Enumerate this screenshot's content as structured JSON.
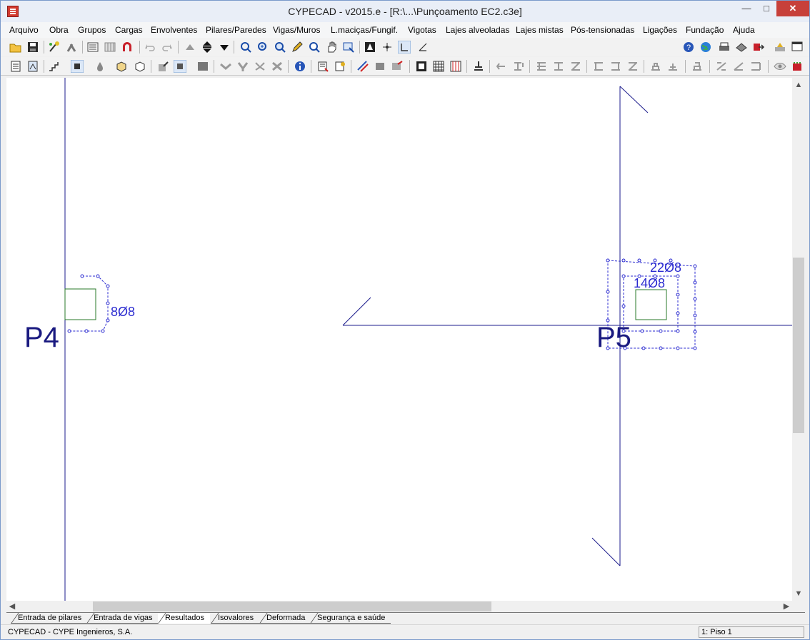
{
  "window": {
    "title": "CYPECAD - v2015.e - [R:\\...\\Punçoamento EC2.c3e]",
    "controls": {
      "minimize": "—",
      "maximize": "□",
      "close": "✕"
    }
  },
  "menu": {
    "items": [
      {
        "label": "Arquivo"
      },
      {
        "label": "Obra"
      },
      {
        "label": "Grupos"
      },
      {
        "label": "Cargas"
      },
      {
        "label": "Envolventes"
      },
      {
        "label": "Pilares/Paredes"
      },
      {
        "label": "Vigas/Muros"
      },
      {
        "label": "L.maciças/Fungif."
      },
      {
        "label": "Vigotas"
      },
      {
        "label": "Lajes alveoladas"
      },
      {
        "label": "Lajes mistas"
      },
      {
        "label": "Pós-tensionadas"
      },
      {
        "label": "Ligações"
      },
      {
        "label": "Fundação"
      },
      {
        "label": "Ajuda"
      }
    ]
  },
  "drawing": {
    "columns": [
      {
        "label": "P4",
        "reinforcement": "8Ø8"
      },
      {
        "label": "P5",
        "reinforcement_outer": "22Ø8",
        "reinforcement_inner": "14Ø8"
      }
    ],
    "colors": {
      "axis_lines": "#1c1c8c",
      "column_outline": "#2a7a2a",
      "punching_perimeter": "#2b2bd0",
      "column_labels": "#1a1a80"
    }
  },
  "tabs": [
    {
      "label": "Entrada de pilares"
    },
    {
      "label": "Entrada de vigas"
    },
    {
      "label": "Resultados"
    },
    {
      "label": "Isovalores"
    },
    {
      "label": "Deformada"
    },
    {
      "label": "Segurança e saúde"
    }
  ],
  "active_tab": "Resultados",
  "status": {
    "left": "CYPECAD - CYPE Ingenieros, S.A.",
    "floor": "1: Piso 1"
  },
  "scroll": {
    "up": "▲",
    "down": "▼",
    "left": "◀",
    "right": "▶"
  }
}
